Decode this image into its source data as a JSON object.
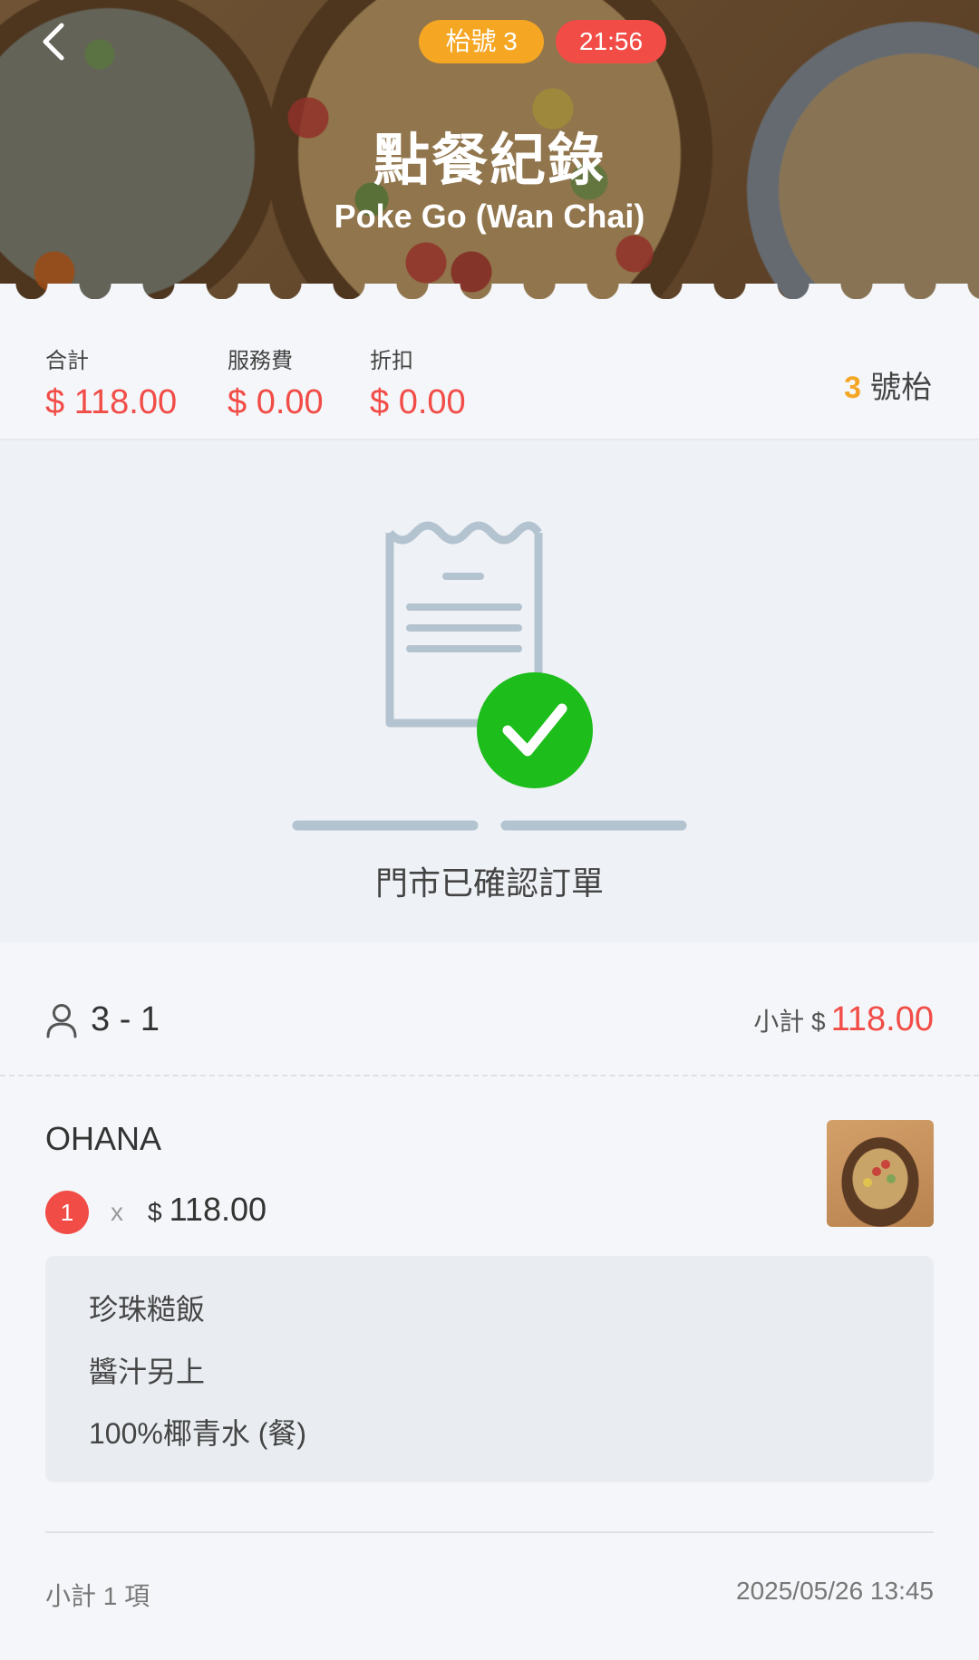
{
  "header": {
    "back_icon": "chevron-left-icon",
    "table_pill": "枱號 3",
    "time_pill": "21:56",
    "title": "點餐紀錄",
    "restaurant": "Poke Go (Wan Chai)"
  },
  "totals": {
    "total_label": "合計",
    "total_value": "$ 118.00",
    "service_label": "服務費",
    "service_value": "$ 0.00",
    "discount_label": "折扣",
    "discount_value": "$ 0.00",
    "table_number": "3",
    "table_suffix": "號枱"
  },
  "status": {
    "icon": "receipt-check-icon",
    "text": "門市已確認訂單"
  },
  "order": {
    "guest_icon": "person-icon",
    "guest_label": "3 - 1",
    "subtotal_label": "小計 $",
    "subtotal_value": "118.00",
    "item": {
      "name": "OHANA",
      "quantity": "1",
      "times": "x",
      "currency": "$",
      "price": "118.00",
      "options": [
        "珍珠糙飯",
        "醬汁另上",
        "100%椰青水 (餐)"
      ]
    },
    "count_label": "小計 1 項",
    "timestamp": "2025/05/26 13:45"
  },
  "colors": {
    "accent_red": "#f24c47",
    "accent_orange": "#f5a623",
    "check_green": "#1dbd1b",
    "receipt_gray": "#b4c3d0"
  }
}
